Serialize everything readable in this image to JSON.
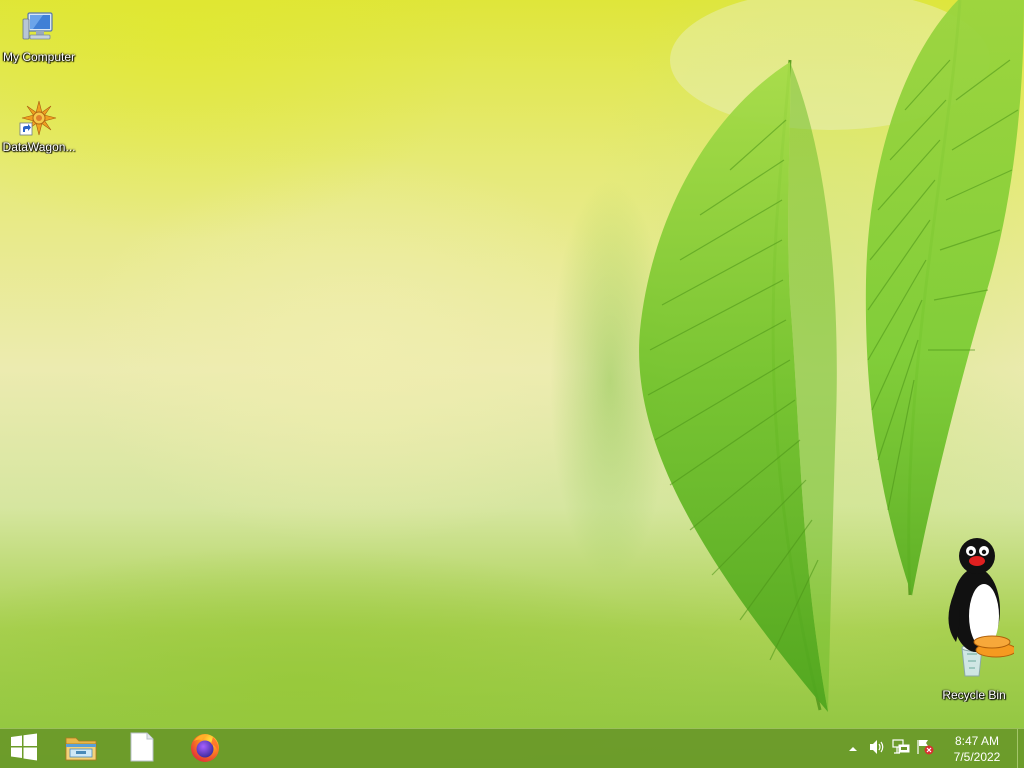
{
  "desktop": {
    "icons": [
      {
        "label": "My Computer",
        "icon": "my-computer-icon"
      },
      {
        "label": "DataWagon...",
        "icon": "datawagon-shortcut-icon"
      },
      {
        "label": "Recycle Bin",
        "icon": "recycle-bin-icon"
      }
    ]
  },
  "taskbar": {
    "start": {
      "icon": "windows-logo-icon"
    },
    "pinned": [
      {
        "icon": "file-explorer-icon"
      },
      {
        "icon": "blank-document-icon"
      },
      {
        "icon": "firefox-icon"
      }
    ],
    "tray": {
      "icons": [
        "show-hidden-icons-chevron",
        "volume-icon",
        "network-icon",
        "action-center-flag-icon"
      ],
      "time": "8:47 AM",
      "date": "7/5/2022"
    }
  },
  "colors": {
    "taskbar": "#6a9628",
    "wallpaper_top": "#dfe63a",
    "wallpaper_bottom": "#8cc43e",
    "leaf": "#7ec832"
  }
}
